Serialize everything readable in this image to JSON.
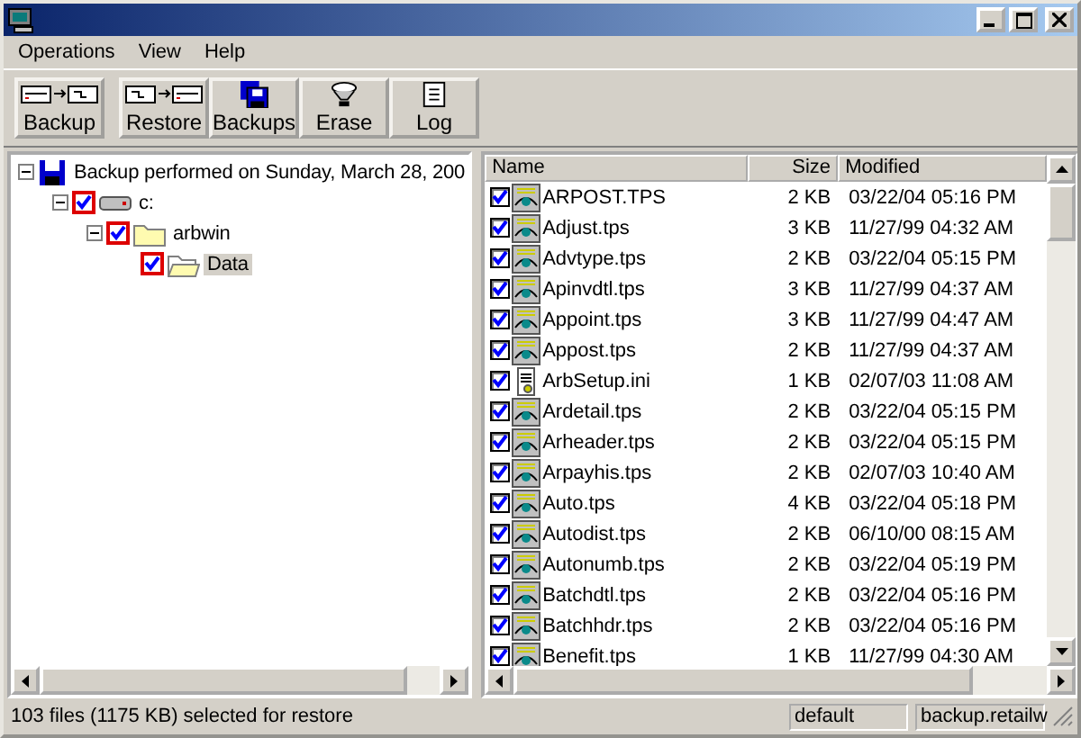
{
  "menu": [
    "Operations",
    "View",
    "Help"
  ],
  "toolbar": [
    {
      "label": "Backup",
      "kind": "backup"
    },
    {
      "label": "Restore",
      "kind": "restore"
    },
    {
      "label": "Backups",
      "kind": "backups"
    },
    {
      "label": "Erase",
      "kind": "erase"
    },
    {
      "label": "Log",
      "kind": "log"
    }
  ],
  "tree": [
    {
      "label": "Backup performed on Sunday, March 28, 200",
      "kind": "backup",
      "expanded": true,
      "children": [
        {
          "label": "c:",
          "kind": "drive",
          "checked": true,
          "expanded": true,
          "children": [
            {
              "label": "arbwin",
              "kind": "folder",
              "checked": true,
              "expanded": true,
              "children": [
                {
                  "label": "Data",
                  "kind": "open-folder",
                  "checked": true,
                  "selected": true
                }
              ]
            }
          ]
        }
      ]
    }
  ],
  "table": {
    "columns": [
      "Name",
      "Size",
      "Modified"
    ],
    "rows": [
      {
        "name": "ARPOST.TPS",
        "size": "2 KB",
        "modified": "03/22/04 05:16 PM",
        "kind": "tps",
        "checked": true
      },
      {
        "name": "Adjust.tps",
        "size": "3 KB",
        "modified": "11/27/99 04:32 AM",
        "kind": "tps",
        "checked": true
      },
      {
        "name": "Advtype.tps",
        "size": "2 KB",
        "modified": "03/22/04 05:15 PM",
        "kind": "tps",
        "checked": true
      },
      {
        "name": "Apinvdtl.tps",
        "size": "3 KB",
        "modified": "11/27/99 04:37 AM",
        "kind": "tps",
        "checked": true
      },
      {
        "name": "Appoint.tps",
        "size": "3 KB",
        "modified": "11/27/99 04:47 AM",
        "kind": "tps",
        "checked": true
      },
      {
        "name": "Appost.tps",
        "size": "2 KB",
        "modified": "11/27/99 04:37 AM",
        "kind": "tps",
        "checked": true
      },
      {
        "name": "ArbSetup.ini",
        "size": "1 KB",
        "modified": "02/07/03 11:08 AM",
        "kind": "ini",
        "checked": true
      },
      {
        "name": "Ardetail.tps",
        "size": "2 KB",
        "modified": "03/22/04 05:15 PM",
        "kind": "tps",
        "checked": true
      },
      {
        "name": "Arheader.tps",
        "size": "2 KB",
        "modified": "03/22/04 05:15 PM",
        "kind": "tps",
        "checked": true
      },
      {
        "name": "Arpayhis.tps",
        "size": "2 KB",
        "modified": "02/07/03 10:40 AM",
        "kind": "tps",
        "checked": true
      },
      {
        "name": "Auto.tps",
        "size": "4 KB",
        "modified": "03/22/04 05:18 PM",
        "kind": "tps",
        "checked": true
      },
      {
        "name": "Autodist.tps",
        "size": "2 KB",
        "modified": "06/10/00 08:15 AM",
        "kind": "tps",
        "checked": true
      },
      {
        "name": "Autonumb.tps",
        "size": "2 KB",
        "modified": "03/22/04 05:19 PM",
        "kind": "tps",
        "checked": true
      },
      {
        "name": "Batchdtl.tps",
        "size": "2 KB",
        "modified": "03/22/04 05:16 PM",
        "kind": "tps",
        "checked": true
      },
      {
        "name": "Batchhdr.tps",
        "size": "2 KB",
        "modified": "03/22/04 05:16 PM",
        "kind": "tps",
        "checked": true
      },
      {
        "name": "Benefit.tps",
        "size": "1 KB",
        "modified": "11/27/99 04:30 AM",
        "kind": "tps",
        "checked": true
      }
    ]
  },
  "status_bar": {
    "message": "103 files (1175 KB) selected for restore",
    "profile": "default",
    "file": "backup.retailw"
  }
}
